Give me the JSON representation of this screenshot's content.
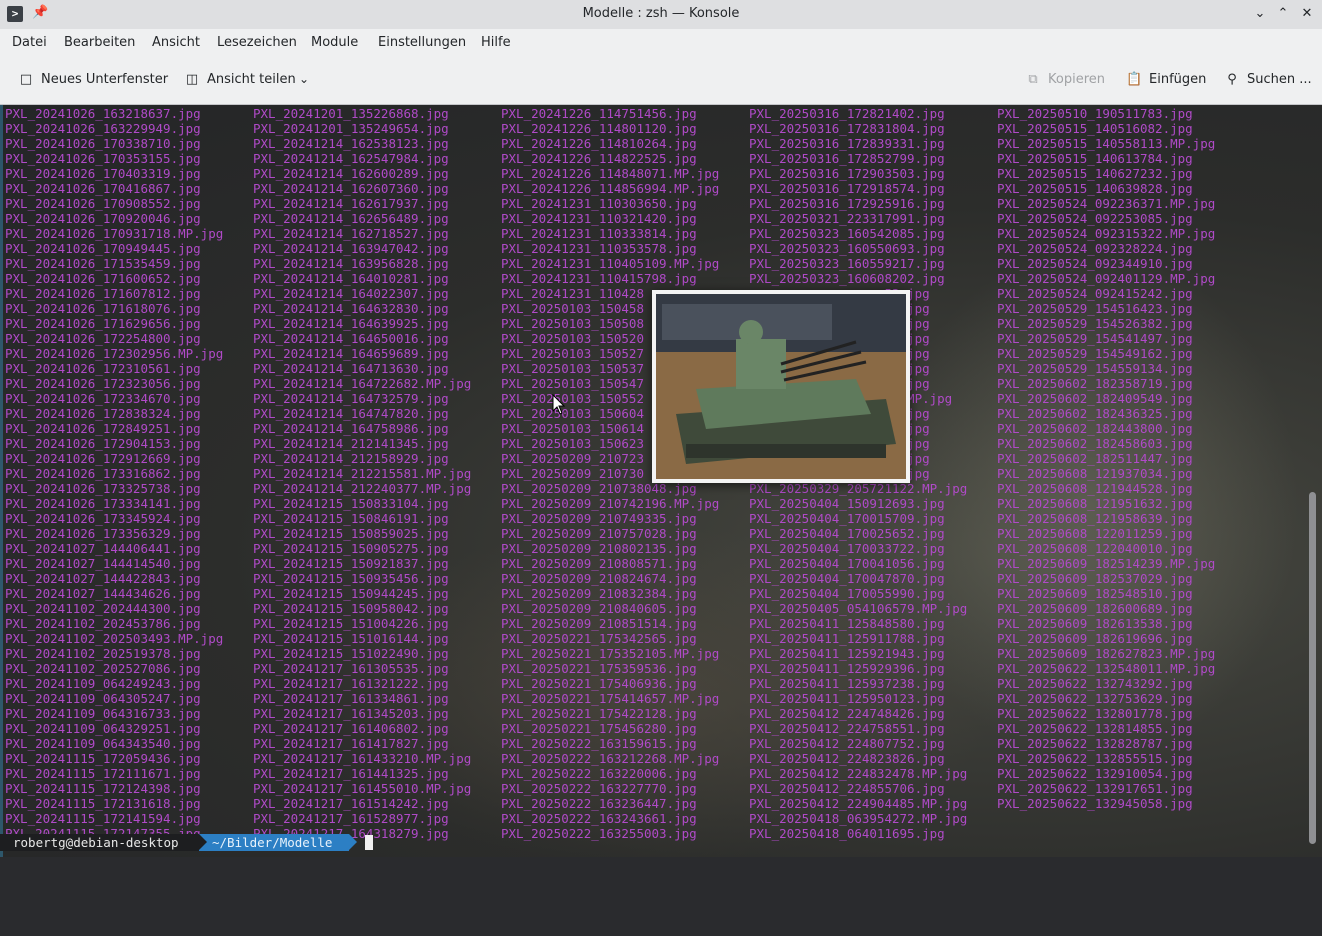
{
  "window": {
    "title": "Modelle : zsh — Konsole"
  },
  "menu": [
    "Datei",
    "Bearbeiten",
    "Ansicht",
    "Lesezeichen",
    "Module",
    "Einstellungen",
    "Hilfe"
  ],
  "toolbar": {
    "new_tab": "Neues Unterfenster",
    "split_view": "Ansicht teilen",
    "copy": "Kopieren",
    "paste": "Einfügen",
    "search": "Suchen ..."
  },
  "icons": [
    "terminal-app-icon",
    "pin-icon",
    "minimize-icon",
    "maximize-icon",
    "close-icon",
    "new-tab-icon",
    "split-view-icon",
    "chevron-down-icon",
    "copy-icon",
    "paste-icon",
    "search-icon",
    "mouse-cursor-icon"
  ],
  "colors": {
    "file_text": "#b04ac8",
    "prompt_user_bg": "#1d1e20",
    "prompt_path_bg": "#2c7fc4"
  },
  "files": {
    "col1": [
      "PXL_20241026_163218637.jpg",
      "PXL_20241026_163229949.jpg",
      "PXL_20241026_170338710.jpg",
      "PXL_20241026_170353155.jpg",
      "PXL_20241026_170403319.jpg",
      "PXL_20241026_170416867.jpg",
      "PXL_20241026_170908552.jpg",
      "PXL_20241026_170920046.jpg",
      "PXL_20241026_170931718.MP.jpg",
      "PXL_20241026_170949445.jpg",
      "PXL_20241026_171535459.jpg",
      "PXL_20241026_171600652.jpg",
      "PXL_20241026_171607812.jpg",
      "PXL_20241026_171618076.jpg",
      "PXL_20241026_171629656.jpg",
      "PXL_20241026_172254800.jpg",
      "PXL_20241026_172302956.MP.jpg",
      "PXL_20241026_172310561.jpg",
      "PXL_20241026_172323056.jpg",
      "PXL_20241026_172334670.jpg",
      "PXL_20241026_172838324.jpg",
      "PXL_20241026_172849251.jpg",
      "PXL_20241026_172904153.jpg",
      "PXL_20241026_172912669.jpg",
      "PXL_20241026_173316862.jpg",
      "PXL_20241026_173325738.jpg",
      "PXL_20241026_173334141.jpg",
      "PXL_20241026_173345924.jpg",
      "PXL_20241026_173356329.jpg",
      "PXL_20241027_144406441.jpg",
      "PXL_20241027_144414540.jpg",
      "PXL_20241027_144422843.jpg",
      "PXL_20241027_144434626.jpg",
      "PXL_20241102_202444300.jpg",
      "PXL_20241102_202453786.jpg",
      "PXL_20241102_202503493.MP.jpg",
      "PXL_20241102_202519378.jpg",
      "PXL_20241102_202527086.jpg",
      "PXL_20241109_064249243.jpg",
      "PXL_20241109_064305247.jpg",
      "PXL_20241109_064316733.jpg",
      "PXL_20241109_064329251.jpg",
      "PXL_20241109_064343540.jpg",
      "PXL_20241115_172059436.jpg",
      "PXL_20241115_172111671.jpg",
      "PXL_20241115_172124398.jpg",
      "PXL_20241115_172131618.jpg",
      "PXL_20241115_172141594.jpg",
      "PXL_20241115_172147355.jpg"
    ],
    "col2": [
      "PXL_20241201_135226868.jpg",
      "PXL_20241201_135249654.jpg",
      "PXL_20241214_162538123.jpg",
      "PXL_20241214_162547984.jpg",
      "PXL_20241214_162600289.jpg",
      "PXL_20241214_162607360.jpg",
      "PXL_20241214_162617937.jpg",
      "PXL_20241214_162656489.jpg",
      "PXL_20241214_162718527.jpg",
      "PXL_20241214_163947042.jpg",
      "PXL_20241214_163956828.jpg",
      "PXL_20241214_164010281.jpg",
      "PXL_20241214_164022307.jpg",
      "PXL_20241214_164632830.jpg",
      "PXL_20241214_164639925.jpg",
      "PXL_20241214_164650016.jpg",
      "PXL_20241214_164659689.jpg",
      "PXL_20241214_164713630.jpg",
      "PXL_20241214_164722682.MP.jpg",
      "PXL_20241214_164732579.jpg",
      "PXL_20241214_164747820.jpg",
      "PXL_20241214_164758986.jpg",
      "PXL_20241214_212141345.jpg",
      "PXL_20241214_212158929.jpg",
      "PXL_20241214_212215581.MP.jpg",
      "PXL_20241214_212240377.MP.jpg",
      "PXL_20241215_150833104.jpg",
      "PXL_20241215_150846191.jpg",
      "PXL_20241215_150859025.jpg",
      "PXL_20241215_150905275.jpg",
      "PXL_20241215_150921837.jpg",
      "PXL_20241215_150935456.jpg",
      "PXL_20241215_150944245.jpg",
      "PXL_20241215_150958042.jpg",
      "PXL_20241215_151004226.jpg",
      "PXL_20241215_151016144.jpg",
      "PXL_20241215_151022490.jpg",
      "PXL_20241217_161305535.jpg",
      "PXL_20241217_161321222.jpg",
      "PXL_20241217_161334861.jpg",
      "PXL_20241217_161345203.jpg",
      "PXL_20241217_161406802.jpg",
      "PXL_20241217_161417827.jpg",
      "PXL_20241217_161433210.MP.jpg",
      "PXL_20241217_161441325.jpg",
      "PXL_20241217_161455010.MP.jpg",
      "PXL_20241217_161514242.jpg",
      "PXL_20241217_161528977.jpg",
      "PXL_20241217_164318279.jpg"
    ],
    "col3": [
      "PXL_20241226_114751456.jpg",
      "PXL_20241226_114801120.jpg",
      "PXL_20241226_114810264.jpg",
      "PXL_20241226_114822525.jpg",
      "PXL_20241226_114848071.MP.jpg",
      "PXL_20241226_114856994.MP.jpg",
      "PXL_20241231_110303650.jpg",
      "PXL_20241231_110321420.jpg",
      "PXL_20241231_110333814.jpg",
      "PXL_20241231_110353578.jpg",
      "PXL_20241231_110405109.MP.jpg",
      "PXL_20241231_110415798.jpg",
      "PXL_20241231_110428",
      "PXL_20250103_150458",
      "PXL_20250103_150508",
      "PXL_20250103_150520",
      "PXL_20250103_150527",
      "PXL_20250103_150537",
      "PXL_20250103_150547",
      "PXL_20250103_150552",
      "PXL_20250103_150604",
      "PXL_20250103_150614",
      "PXL_20250103_150623",
      "PXL_20250209_210723",
      "PXL_20250209_210730",
      "PXL_20250209_210738048.jpg",
      "PXL_20250209_210742196.MP.jpg",
      "PXL_20250209_210749335.jpg",
      "PXL_20250209_210757028.jpg",
      "PXL_20250209_210802135.jpg",
      "PXL_20250209_210808571.jpg",
      "PXL_20250209_210824674.jpg",
      "PXL_20250209_210832384.jpg",
      "PXL_20250209_210840605.jpg",
      "PXL_20250209_210851514.jpg",
      "PXL_20250221_175342565.jpg",
      "PXL_20250221_175352105.MP.jpg",
      "PXL_20250221_175359536.jpg",
      "PXL_20250221_175406936.jpg",
      "PXL_20250221_175414657.MP.jpg",
      "PXL_20250221_175422128.jpg",
      "PXL_20250221_175456280.jpg",
      "PXL_20250222_163159615.jpg",
      "PXL_20250222_163212268.MP.jpg",
      "PXL_20250222_163220006.jpg",
      "PXL_20250222_163227770.jpg",
      "PXL_20250222_163236447.jpg",
      "PXL_20250222_163243661.jpg",
      "PXL_20250222_163255003.jpg"
    ],
    "col4": [
      "PXL_20250316_172821402.jpg",
      "PXL_20250316_172831804.jpg",
      "PXL_20250316_172839331.jpg",
      "PXL_20250316_172852799.jpg",
      "PXL_20250316_172903503.jpg",
      "PXL_20250316_172918574.jpg",
      "PXL_20250316_172925916.jpg",
      "PXL_20250321_223317991.jpg",
      "PXL_20250323_160542085.jpg",
      "PXL_20250323_160550693.jpg",
      "PXL_20250323_160559217.jpg",
      "PXL_20250323_160608202.jpg",
      "                  53.jpg",
      "                  32.jpg",
      "                  04.jpg",
      "                  53.jpg",
      "                  39.jpg",
      "                  19.jpg",
      "                  67.jpg",
      "                  28.MP.jpg",
      "                  19.jpg",
      "                  95.jpg",
      "                  68.jpg",
      "                  18.jpg",
      "                  47.jpg",
      "PXL_20250329_205721122.MP.jpg",
      "PXL_20250404_150912693.jpg",
      "PXL_20250404_170015709.jpg",
      "PXL_20250404_170025652.jpg",
      "PXL_20250404_170033722.jpg",
      "PXL_20250404_170041056.jpg",
      "PXL_20250404_170047870.jpg",
      "PXL_20250404_170055990.jpg",
      "PXL_20250405_054106579.MP.jpg",
      "PXL_20250411_125848580.jpg",
      "PXL_20250411_125911788.jpg",
      "PXL_20250411_125921943.jpg",
      "PXL_20250411_125929396.jpg",
      "PXL_20250411_125937238.jpg",
      "PXL_20250411_125950123.jpg",
      "PXL_20250412_224748426.jpg",
      "PXL_20250412_224758551.jpg",
      "PXL_20250412_224807752.jpg",
      "PXL_20250412_224823826.jpg",
      "PXL_20250412_224832478.MP.jpg",
      "PXL_20250412_224855706.jpg",
      "PXL_20250412_224904485.MP.jpg",
      "PXL_20250418_063954272.MP.jpg",
      "PXL_20250418_064011695.jpg"
    ],
    "col5": [
      "PXL_20250510_190511783.jpg",
      "PXL_20250515_140516082.jpg",
      "PXL_20250515_140558113.MP.jpg",
      "PXL_20250515_140613784.jpg",
      "PXL_20250515_140627232.jpg",
      "PXL_20250515_140639828.jpg",
      "PXL_20250524_092236371.MP.jpg",
      "PXL_20250524_092253085.jpg",
      "PXL_20250524_092315322.MP.jpg",
      "PXL_20250524_092328224.jpg",
      "PXL_20250524_092344910.jpg",
      "PXL_20250524_092401129.MP.jpg",
      "PXL_20250524_092415242.jpg",
      "PXL_20250529_154516423.jpg",
      "PXL_20250529_154526382.jpg",
      "PXL_20250529_154541497.jpg",
      "PXL_20250529_154549162.jpg",
      "PXL_20250529_154559134.jpg",
      "PXL_20250602_182358719.jpg",
      "PXL_20250602_182409549.jpg",
      "PXL_20250602_182436325.jpg",
      "PXL_20250602_182443800.jpg",
      "PXL_20250602_182458603.jpg",
      "PXL_20250602_182511447.jpg",
      "PXL_20250608_121937034.jpg",
      "PXL_20250608_121944528.jpg",
      "PXL_20250608_121951632.jpg",
      "PXL_20250608_121958639.jpg",
      "PXL_20250608_122011259.jpg",
      "PXL_20250608_122040010.jpg",
      "PXL_20250609_182514239.MP.jpg",
      "PXL_20250609_182537029.jpg",
      "PXL_20250609_182548510.jpg",
      "PXL_20250609_182600689.jpg",
      "PXL_20250609_182613538.jpg",
      "PXL_20250609_182619696.jpg",
      "PXL_20250609_182627823.MP.jpg",
      "PXL_20250622_132548011.MP.jpg",
      "PXL_20250622_132743292.jpg",
      "PXL_20250622_132753629.jpg",
      "PXL_20250622_132801778.jpg",
      "PXL_20250622_132814855.jpg",
      "PXL_20250622_132828787.jpg",
      "PXL_20250622_132855515.jpg",
      "PXL_20250622_132910054.jpg",
      "PXL_20250622_132917651.jpg",
      "PXL_20250622_132945058.jpg"
    ]
  },
  "prompt": {
    "user": "robertg@debian-desktop",
    "path": "~/Bilder/Modelle"
  }
}
